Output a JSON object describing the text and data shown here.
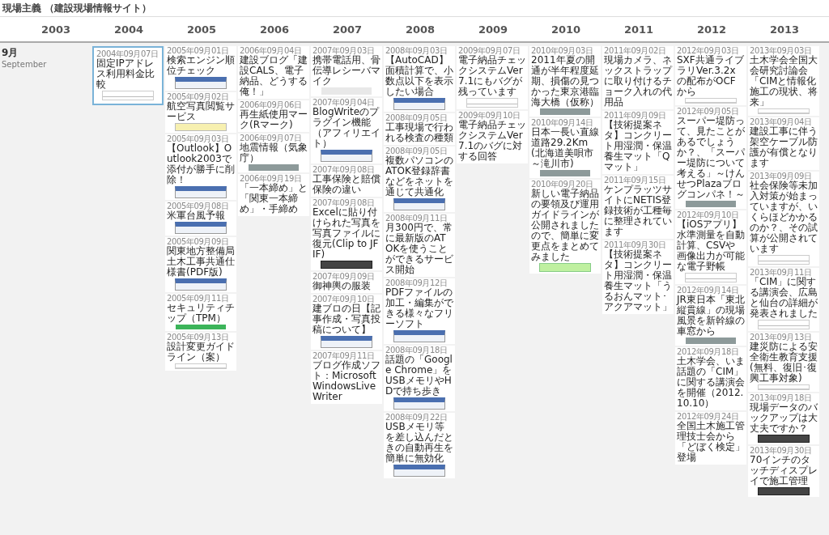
{
  "site_title": "現場主義 （建設現場情報サイト）",
  "years": [
    "2003",
    "2004",
    "2005",
    "2006",
    "2007",
    "2008",
    "2009",
    "2010",
    "2011",
    "2012",
    "2013"
  ],
  "month": {
    "label": "9月",
    "sub": "September"
  },
  "columns": [
    {
      "cards": [
        {
          "date": "2004年09月07日",
          "title": "固定IPアドレス利用料金比較",
          "kind": "table",
          "selected": true
        }
      ]
    },
    {
      "cards": [
        {
          "date": "2005年09月01日",
          "title": "検索エンジン順位チェック",
          "kind": "screenshot",
          "selected": false
        },
        {
          "date": "2005年09月02日",
          "title": "航空写真閲覧サービス",
          "kind": "map",
          "selected": false
        },
        {
          "date": "2005年09月03日",
          "title": "【Outlook】Outlook2003で添付が勝手に削除！",
          "kind": "screenshot",
          "selected": false
        },
        {
          "date": "2005年09月08日",
          "title": "米軍台風予報",
          "kind": "screenshot",
          "selected": false
        },
        {
          "date": "2005年09月09日",
          "title": "関東地方整備局土木工事共通仕様書(PDF版)",
          "kind": "screenshot",
          "selected": false
        },
        {
          "date": "2005年09月11日",
          "title": "セキュリティチップ（TPM）",
          "kind": "chip",
          "selected": false
        },
        {
          "date": "2005年09月13日",
          "title": "設計変更ガイドライン（案）",
          "kind": "document",
          "selected": false
        }
      ]
    },
    {
      "cards": [
        {
          "date": "2006年09月04日",
          "title": "建設ブログ「建設CALS、電子納品、どうする俺！」",
          "kind": "text",
          "selected": false
        },
        {
          "date": "2006年09月06日",
          "title": "再生紙使用マーク(Rマーク)",
          "kind": "text",
          "selected": false
        },
        {
          "date": "2006年09月07日",
          "title": "地震情報（気象庁）",
          "kind": "photo",
          "selected": false
        },
        {
          "date": "2006年09月19日",
          "title": "「一本締め」と「関東一本締め」・手締め",
          "kind": "text",
          "selected": false
        }
      ]
    },
    {
      "cards": [
        {
          "date": "2007年09月03日",
          "title": "携帯電話用、骨伝導レシーバマイク",
          "kind": "product",
          "selected": false
        },
        {
          "date": "2007年09月04日",
          "title": "BlogWriteのプラグイン機能（アフィリエイト）",
          "kind": "screenshot",
          "selected": false
        },
        {
          "date": "2007年09月08日",
          "title": "工事保険と賠償保険の違い",
          "kind": "text",
          "selected": false
        },
        {
          "date": "2007年09月08日",
          "title": "Excelに貼り付けられた写真を写真ファイルに復元(Clip to JFIF)",
          "kind": "dark",
          "selected": false
        },
        {
          "date": "2007年09月09日",
          "title": "御神輿の服装",
          "kind": "text",
          "selected": false
        },
        {
          "date": "2007年09月10日",
          "title": "建ブロの日【記事作成・写真投稿について】",
          "kind": "screenshot",
          "selected": false
        },
        {
          "date": "2007年09月11日",
          "title": "ブログ作成ソフト：Microsoft WindowsLiveWriter",
          "kind": "text",
          "selected": false
        }
      ]
    },
    {
      "cards": [
        {
          "date": "2008年09月03日",
          "title": "【AutoCAD】面積計算で、小数点以下を表示したい場合",
          "kind": "screenshot",
          "selected": false
        },
        {
          "date": "2008年09月05日",
          "title": "工事現場で行われる検査の種類",
          "kind": "text",
          "selected": false
        },
        {
          "date": "2008年09月05日",
          "title": "複数パソコンのATOK登録辞書などをネットを通じて共通化",
          "kind": "screenshot",
          "selected": false
        },
        {
          "date": "2008年09月11日",
          "title": "月300円で、常に最新版のATOKを使うことができるサービス開始",
          "kind": "text",
          "selected": false
        },
        {
          "date": "2008年09月12日",
          "title": "PDFファイルの加工・編集ができる様々なフリーソフト",
          "kind": "screenshot",
          "selected": false
        },
        {
          "date": "2008年09月18日",
          "title": "話題の「Google Chrome」をUSBメモリやHDで持ち歩き",
          "kind": "screenshot",
          "selected": false
        },
        {
          "date": "2008年09月22日",
          "title": "USBメモリ等を差し込んだときの自動再生を簡単に無効化",
          "kind": "screenshot",
          "selected": false
        }
      ]
    },
    {
      "cards": [
        {
          "date": "2009年09月07日",
          "title": "電子納品チェックシステムVer7.1にもバグが残っています",
          "kind": "table",
          "selected": false
        },
        {
          "date": "2009年09月10日",
          "title": "電子納品チェックシステムVer7.1のバグに対する回答",
          "kind": "text",
          "selected": false
        }
      ]
    },
    {
      "cards": [
        {
          "date": "2010年09月03日",
          "title": "2011年夏の開通が半年程度延期、損傷の見つかった東京港臨海大橋（仮称）",
          "kind": "photo",
          "selected": false
        },
        {
          "date": "2010年09月14日",
          "title": "日本一長い直線道路29.2Km(北海道美唄市～滝川市)",
          "kind": "photo",
          "selected": false
        },
        {
          "date": "2010年09月20日",
          "title": "新しい電子納品の要領及び運用ガイドラインが公開されましたので、簡単に変更点をまとめてみました",
          "kind": "diagram",
          "selected": false
        }
      ]
    },
    {
      "cards": [
        {
          "date": "2011年09月02日",
          "title": "現場カメラ、ネックストラップに取り付けるチョーク入れの代用品",
          "kind": "text",
          "selected": false
        },
        {
          "date": "2011年09月09日",
          "title": "【技術提案ネタ】コンクリート用湿潤・保温養生マット「Qマット」",
          "kind": "text",
          "selected": false
        },
        {
          "date": "2011年09月15日",
          "title": "ケンプラッツサイトにNETIS登録技術が工種毎に整理されています",
          "kind": "text",
          "selected": false
        },
        {
          "date": "2011年09月30日",
          "title": "【技術提案ネタ】コンクリート用湿潤・保温養生マット「うるおんマット･アクアマット」",
          "kind": "text",
          "selected": false
        }
      ]
    },
    {
      "cards": [
        {
          "date": "2012年09月03日",
          "title": "SXF共通ライブラリVer.3.2xの配布がOCFから",
          "kind": "document",
          "selected": false
        },
        {
          "date": "2012年09月05日",
          "title": "スーパー堤防って、見たことがあるでしょうか？、「スーパー堤防について考える」～けんせつPlazaブログコンパネ！～",
          "kind": "photo",
          "selected": false
        },
        {
          "date": "2012年09月10日",
          "title": "【iOSアプリ】水準測量を自動計算、CSVや画像出力が可能な電子野帳",
          "kind": "table",
          "selected": false
        },
        {
          "date": "2012年09月14日",
          "title": "JR東日本「東北縦貫線」の現場風景を新幹線の車窓から",
          "kind": "photo",
          "selected": false
        },
        {
          "date": "2012年09月18日",
          "title": "土木学会、いま話題の「CIM」に関する講演会を開催（2012.10.10）",
          "kind": "text",
          "selected": false
        },
        {
          "date": "2012年09月24日",
          "title": "全国土木施工管理技士会から「どぼく検定」登場",
          "kind": "text",
          "selected": false
        }
      ]
    },
    {
      "cards": [
        {
          "date": "2013年09月03日",
          "title": "土木学会全国大会研究討論会「CIMと情報化施工の現状、将来」",
          "kind": "document",
          "selected": false
        },
        {
          "date": "2013年09月04日",
          "title": "建設工事に伴う架空ケーブル防護が有償となります",
          "kind": "text",
          "selected": false
        },
        {
          "date": "2013年09月09日",
          "title": "社会保険等未加入対策が始まっていますが、いくらほどかかるのか？、その試算が公開されています",
          "kind": "table",
          "selected": false
        },
        {
          "date": "2013年09月11日",
          "title": "「CIM」に関する講演会、広島と仙台の詳細が発表されました",
          "kind": "table",
          "selected": false
        },
        {
          "date": "2013年09月13日",
          "title": "建災防による安全衛生教育支援(無料、復旧･復興工事対象)",
          "kind": "document",
          "selected": false
        },
        {
          "date": "2013年09月18日",
          "title": "現場データのバックアップは大丈夫ですか？",
          "kind": "dark",
          "selected": false
        },
        {
          "date": "2013年09月30日",
          "title": "70インチのタッチディスプレイで施工管理",
          "kind": "dark",
          "selected": false
        }
      ]
    }
  ]
}
